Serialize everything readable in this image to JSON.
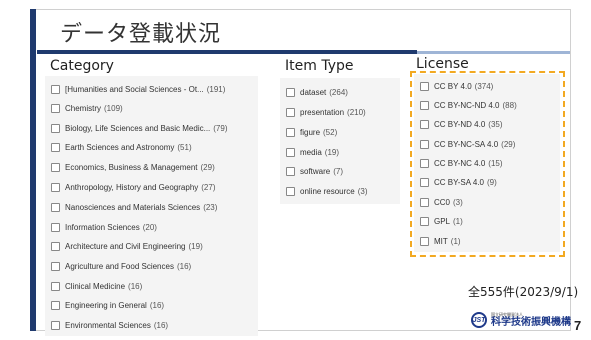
{
  "slide": {
    "title": "データ登載状況",
    "page_number": "7",
    "total_label": "全555件(2023/9/1)"
  },
  "logo": {
    "mark": "JST",
    "small_text": "国立研究開発法人",
    "name": "科学技術振興機構"
  },
  "category": {
    "heading": "Category",
    "items": [
      {
        "label": "[Humanities and Social Sciences - Ot...",
        "count": "(191)"
      },
      {
        "label": "Chemistry",
        "count": "(109)"
      },
      {
        "label": "Biology, Life Sciences and Basic Medic...",
        "count": "(79)"
      },
      {
        "label": "Earth Sciences and Astronomy",
        "count": "(51)"
      },
      {
        "label": "Economics, Business & Management",
        "count": "(29)"
      },
      {
        "label": "Anthropology, History and Geography",
        "count": "(27)"
      },
      {
        "label": "Nanosciences and Materials Sciences",
        "count": "(23)"
      },
      {
        "label": "Information Sciences",
        "count": "(20)"
      },
      {
        "label": "Architecture and Civil Engineering",
        "count": "(19)"
      },
      {
        "label": "Agriculture and Food Sciences",
        "count": "(16)"
      },
      {
        "label": "Clinical Medicine",
        "count": "(16)"
      },
      {
        "label": "Engineering in General",
        "count": "(16)"
      },
      {
        "label": "Environmental Sciences",
        "count": "(16)"
      }
    ]
  },
  "item_type": {
    "heading": "Item Type",
    "items": [
      {
        "label": "dataset",
        "count": "(264)"
      },
      {
        "label": "presentation",
        "count": "(210)"
      },
      {
        "label": "figure",
        "count": "(52)"
      },
      {
        "label": "media",
        "count": "(19)"
      },
      {
        "label": "software",
        "count": "(7)"
      },
      {
        "label": "online resource",
        "count": "(3)"
      }
    ]
  },
  "license": {
    "heading": "License",
    "items": [
      {
        "label": "CC BY 4.0",
        "count": "(374)"
      },
      {
        "label": "CC BY-NC-ND 4.0",
        "count": "(88)"
      },
      {
        "label": "CC BY-ND 4.0",
        "count": "(35)"
      },
      {
        "label": "CC BY-NC-SA 4.0",
        "count": "(29)"
      },
      {
        "label": "CC BY-NC 4.0",
        "count": "(15)"
      },
      {
        "label": "CC BY-SA 4.0",
        "count": "(9)"
      },
      {
        "label": "CC0",
        "count": "(3)"
      },
      {
        "label": "GPL",
        "count": "(1)"
      },
      {
        "label": "MIT",
        "count": "(1)"
      }
    ]
  },
  "colors": {
    "accent_navy": "#1f3a6e",
    "highlight_orange": "#f2a922"
  }
}
